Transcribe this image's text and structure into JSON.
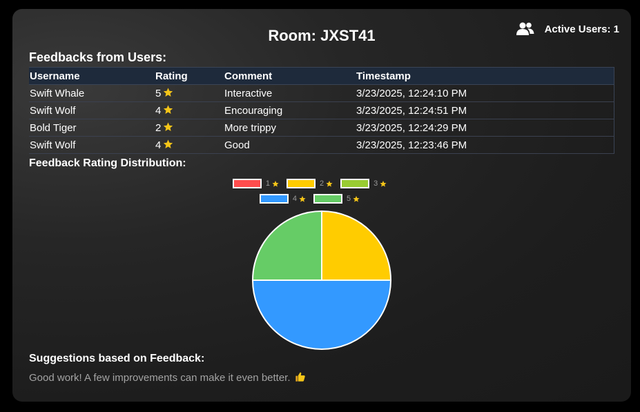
{
  "room": {
    "title": "Room: JXST41"
  },
  "active_users": {
    "label": "Active Users: 1",
    "icon": "users-icon"
  },
  "feedbacks": {
    "title": "Feedbacks from Users:",
    "columns": [
      "Username",
      "Rating",
      "Comment",
      "Timestamp"
    ],
    "rows": [
      {
        "username": "Swift Whale",
        "rating": "5",
        "comment": "Interactive",
        "timestamp": "3/23/2025, 12:24:10 PM"
      },
      {
        "username": "Swift Wolf",
        "rating": "4",
        "comment": "Encouraging",
        "timestamp": "3/23/2025, 12:24:51 PM"
      },
      {
        "username": "Bold Tiger",
        "rating": "2",
        "comment": "More trippy",
        "timestamp": "3/23/2025, 12:24:29 PM"
      },
      {
        "username": "Swift Wolf",
        "rating": "4",
        "comment": "Good",
        "timestamp": "3/23/2025, 12:23:46 PM"
      }
    ]
  },
  "distribution": {
    "title": "Feedback Rating Distribution:"
  },
  "chart_data": {
    "type": "pie",
    "title": "",
    "legend_placement": "top",
    "categories": [
      "1",
      "2",
      "3",
      "4",
      "5"
    ],
    "values": [
      0,
      1,
      0,
      2,
      1
    ],
    "colors": [
      "#ff4d4d",
      "#ffcc00",
      "#99cc33",
      "#3399ff",
      "#66cc66"
    ]
  },
  "suggestions": {
    "title": "Suggestions based on Feedback:",
    "text": "Good work! A few improvements can make it even better.",
    "icon": "thumbs-up-icon"
  },
  "colors": {
    "star": "#f5c518",
    "background": "#1f1f1f",
    "header_bg": "#1e2a3b"
  }
}
